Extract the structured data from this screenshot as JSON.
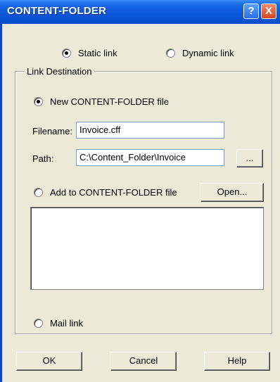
{
  "window": {
    "title": "CONTENT-FOLDER",
    "help_glyph": "?",
    "close_glyph": "X"
  },
  "link_type": {
    "static_label": "Static link",
    "dynamic_label": "Dynamic link",
    "selected": "static"
  },
  "destination": {
    "group_label": "Link Destination",
    "new_file_label": "New CONTENT-FOLDER file",
    "filename_label": "Filename:",
    "filename_value": "Invoice.cff",
    "path_label": "Path:",
    "path_value": "C:\\Content_Folder\\Invoice",
    "browse_label": "...",
    "add_label": "Add to CONTENT-FOLDER file",
    "open_label": "Open...",
    "mail_label": "Mail link",
    "selected": "new"
  },
  "buttons": {
    "ok_label": "OK",
    "cancel_label": "Cancel",
    "help_label": "Help"
  },
  "icons": {
    "help": "help-icon",
    "close": "close-icon",
    "radio": "radio-icon"
  },
  "colors": {
    "titlebar": "#0a56d8",
    "dialog_bg": "#ece9d8",
    "close_red": "#d4451e"
  }
}
